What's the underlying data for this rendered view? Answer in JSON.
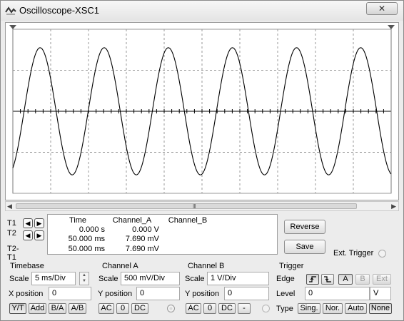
{
  "window": {
    "title": "Oscilloscope-XSC1",
    "close_label": "✕"
  },
  "scrollbar": {
    "left_arrow": "◀",
    "right_arrow": "▶",
    "grip": "III"
  },
  "cursors": [
    {
      "label": "T1"
    },
    {
      "label": "T2"
    },
    {
      "label": "T2-T1"
    }
  ],
  "readout": {
    "headers": {
      "time": "Time",
      "channel_a": "Channel_A",
      "channel_b": "Channel_B"
    },
    "rows": [
      {
        "time": "0.000 s",
        "channel_a": "0.000 V",
        "channel_b": ""
      },
      {
        "time": "50.000 ms",
        "channel_a": "7.690 mV",
        "channel_b": ""
      },
      {
        "time": "50.000 ms",
        "channel_a": "7.690 mV",
        "channel_b": ""
      }
    ]
  },
  "buttons": {
    "reverse": "Reverse",
    "save": "Save"
  },
  "ext_trigger_label": "Ext. Trigger",
  "timebase": {
    "title": "Timebase",
    "scale_label": "Scale",
    "scale_value": "5 ms/Div",
    "xpos_label": "X position",
    "xpos_value": "0",
    "modes": [
      "Y/T",
      "Add",
      "B/A",
      "A/B"
    ]
  },
  "channel_a": {
    "title": "Channel A",
    "scale_label": "Scale",
    "scale_value": "500 mV/Div",
    "ypos_label": "Y position",
    "ypos_value": "0",
    "coupling": [
      "AC",
      "0",
      "DC"
    ]
  },
  "channel_b": {
    "title": "Channel B",
    "scale_label": "Scale",
    "scale_value": "1 V/Div",
    "ypos_label": "Y position",
    "ypos_value": "0",
    "coupling": [
      "AC",
      "0",
      "DC",
      "-"
    ]
  },
  "trigger": {
    "title": "Trigger",
    "edge_label": "Edge",
    "edge_buttons": [
      "A",
      "B",
      "Ext"
    ],
    "level_label": "Level",
    "level_value": "0",
    "level_unit": "V",
    "type_label": "Type",
    "types": [
      "Sing.",
      "Nor.",
      "Auto",
      "None"
    ]
  },
  "colors": {
    "trace": "#000000",
    "grid": "#9a9a9a",
    "window_bg": "#ececec"
  },
  "icons": {
    "app": "oscilloscope-icon",
    "cursor_left": "arrow-left-icon",
    "cursor_right": "arrow-right-icon"
  }
}
